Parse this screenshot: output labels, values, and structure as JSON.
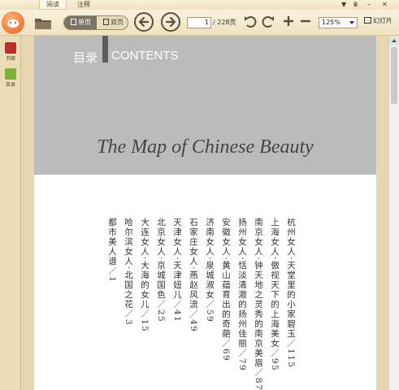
{
  "tabs": {
    "read": "阅读",
    "annotate": "注释"
  },
  "window_controls": {
    "settings": "▼",
    "skin": "♛",
    "minimize": "–",
    "close": "✕"
  },
  "toolbar": {
    "single_page": "单页",
    "double_page": "双页",
    "current_page": "1",
    "total_pages": "/ 228页",
    "zoom": "125%",
    "slideshow": "幻灯片"
  },
  "sidebar": {
    "shelf": "书面",
    "toc": "目录"
  },
  "page": {
    "toc_cn": "目录",
    "toc_en": "CONTENTS",
    "book_title": "The Map of  Chinese Beauty",
    "entries": [
      "杭州女人·天堂里的小家碧玉／115",
      "上海女人·傲视天下的上海美女／95",
      "南京女人·钟天地之灵秀的南京美眉／87",
      "扬州女人·恬淡清澈的扬州佳丽／79",
      "安徽女人·黄山蕴育出的奇葩／69",
      "济南女人·泉城淑女／59",
      "石家庄女人·燕赵风流／49",
      "天津女人·天津妞儿／41",
      "北京女人·京城国色／25",
      "大连女人·大海的女儿／15",
      "哈尔滨女人·北国之花／3",
      "都市美人谱／1"
    ]
  },
  "colors": {
    "header_gray": "#bbbbbc",
    "toolbar": "#efe2bf",
    "accent": "#e4601e"
  }
}
